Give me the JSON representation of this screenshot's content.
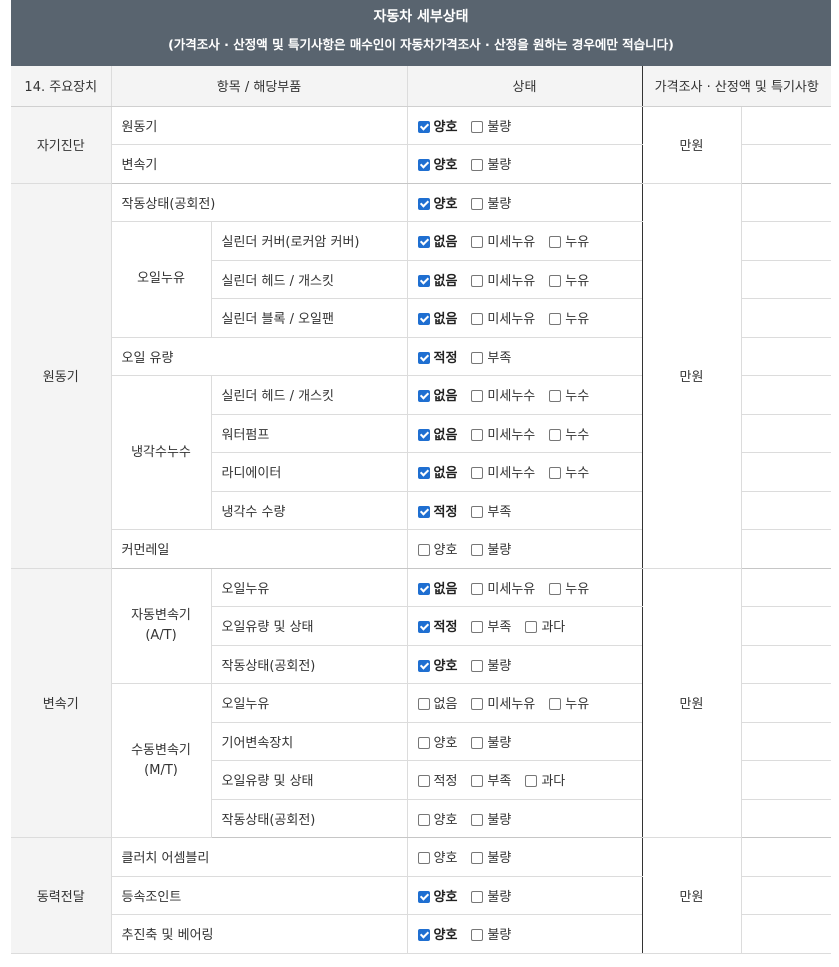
{
  "header": {
    "title": "자동차 세부상태",
    "subtitle": "(가격조사 · 산정액 및 특기사항은 매수인이 자동차가격조사 · 산정을 원하는 경우에만 적습니다)"
  },
  "columns": {
    "device": "14. 주요장치",
    "item": "항목 / 해당부품",
    "status": "상태",
    "price": "가격조사 · 산정액 및 특기사항"
  },
  "units": {
    "price": "만원"
  },
  "sections": {
    "self_diag": "자기진단",
    "engine": "원동기",
    "transmission": "변속기",
    "power": "동력전달"
  },
  "subgroups": {
    "oil_leak": "오일누유",
    "coolant_leak": "냉각수누수",
    "auto": "자동변속기\n(A/T)",
    "manual": "수동변속기\n(M/T)"
  },
  "rows": [
    {
      "item": "원동기",
      "options": [
        {
          "label": "양호",
          "checked": true
        },
        {
          "label": "불량",
          "checked": false
        }
      ]
    },
    {
      "item": "변속기",
      "options": [
        {
          "label": "양호",
          "checked": true
        },
        {
          "label": "불량",
          "checked": false
        }
      ]
    },
    {
      "item": "작동상태(공회전)",
      "options": [
        {
          "label": "양호",
          "checked": true
        },
        {
          "label": "불량",
          "checked": false
        }
      ]
    },
    {
      "item": "실린더 커버(로커암 커버)",
      "options": [
        {
          "label": "없음",
          "checked": true
        },
        {
          "label": "미세누유",
          "checked": false
        },
        {
          "label": "누유",
          "checked": false
        }
      ]
    },
    {
      "item": "실린더 헤드 / 개스킷",
      "options": [
        {
          "label": "없음",
          "checked": true
        },
        {
          "label": "미세누유",
          "checked": false
        },
        {
          "label": "누유",
          "checked": false
        }
      ]
    },
    {
      "item": "실린더 블록 / 오일팬",
      "options": [
        {
          "label": "없음",
          "checked": true
        },
        {
          "label": "미세누유",
          "checked": false
        },
        {
          "label": "누유",
          "checked": false
        }
      ]
    },
    {
      "item": "오일 유량",
      "options": [
        {
          "label": "적정",
          "checked": true
        },
        {
          "label": "부족",
          "checked": false
        }
      ]
    },
    {
      "item": "실린더 헤드 / 개스킷",
      "options": [
        {
          "label": "없음",
          "checked": true
        },
        {
          "label": "미세누수",
          "checked": false
        },
        {
          "label": "누수",
          "checked": false
        }
      ]
    },
    {
      "item": "워터펌프",
      "options": [
        {
          "label": "없음",
          "checked": true
        },
        {
          "label": "미세누수",
          "checked": false
        },
        {
          "label": "누수",
          "checked": false
        }
      ]
    },
    {
      "item": "라디에이터",
      "options": [
        {
          "label": "없음",
          "checked": true
        },
        {
          "label": "미세누수",
          "checked": false
        },
        {
          "label": "누수",
          "checked": false
        }
      ]
    },
    {
      "item": "냉각수 수량",
      "options": [
        {
          "label": "적정",
          "checked": true
        },
        {
          "label": "부족",
          "checked": false
        }
      ]
    },
    {
      "item": "커먼레일",
      "options": [
        {
          "label": "양호",
          "checked": false
        },
        {
          "label": "불량",
          "checked": false
        }
      ]
    },
    {
      "item": "오일누유",
      "options": [
        {
          "label": "없음",
          "checked": true
        },
        {
          "label": "미세누유",
          "checked": false
        },
        {
          "label": "누유",
          "checked": false
        }
      ]
    },
    {
      "item": "오일유량 및 상태",
      "options": [
        {
          "label": "적정",
          "checked": true
        },
        {
          "label": "부족",
          "checked": false
        },
        {
          "label": "과다",
          "checked": false
        }
      ]
    },
    {
      "item": "작동상태(공회전)",
      "options": [
        {
          "label": "양호",
          "checked": true
        },
        {
          "label": "불량",
          "checked": false
        }
      ]
    },
    {
      "item": "오일누유",
      "options": [
        {
          "label": "없음",
          "checked": false
        },
        {
          "label": "미세누유",
          "checked": false
        },
        {
          "label": "누유",
          "checked": false
        }
      ]
    },
    {
      "item": "기어변속장치",
      "options": [
        {
          "label": "양호",
          "checked": false
        },
        {
          "label": "불량",
          "checked": false
        }
      ]
    },
    {
      "item": "오일유량 및 상태",
      "options": [
        {
          "label": "적정",
          "checked": false
        },
        {
          "label": "부족",
          "checked": false
        },
        {
          "label": "과다",
          "checked": false
        }
      ]
    },
    {
      "item": "작동상태(공회전)",
      "options": [
        {
          "label": "양호",
          "checked": false
        },
        {
          "label": "불량",
          "checked": false
        }
      ]
    },
    {
      "item": "클러치 어셈블리",
      "options": [
        {
          "label": "양호",
          "checked": false
        },
        {
          "label": "불량",
          "checked": false
        }
      ]
    },
    {
      "item": "등속조인트",
      "options": [
        {
          "label": "양호",
          "checked": true
        },
        {
          "label": "불량",
          "checked": false
        }
      ]
    },
    {
      "item": "추진축 및 베어링",
      "options": [
        {
          "label": "양호",
          "checked": true
        },
        {
          "label": "불량",
          "checked": false
        }
      ]
    }
  ]
}
